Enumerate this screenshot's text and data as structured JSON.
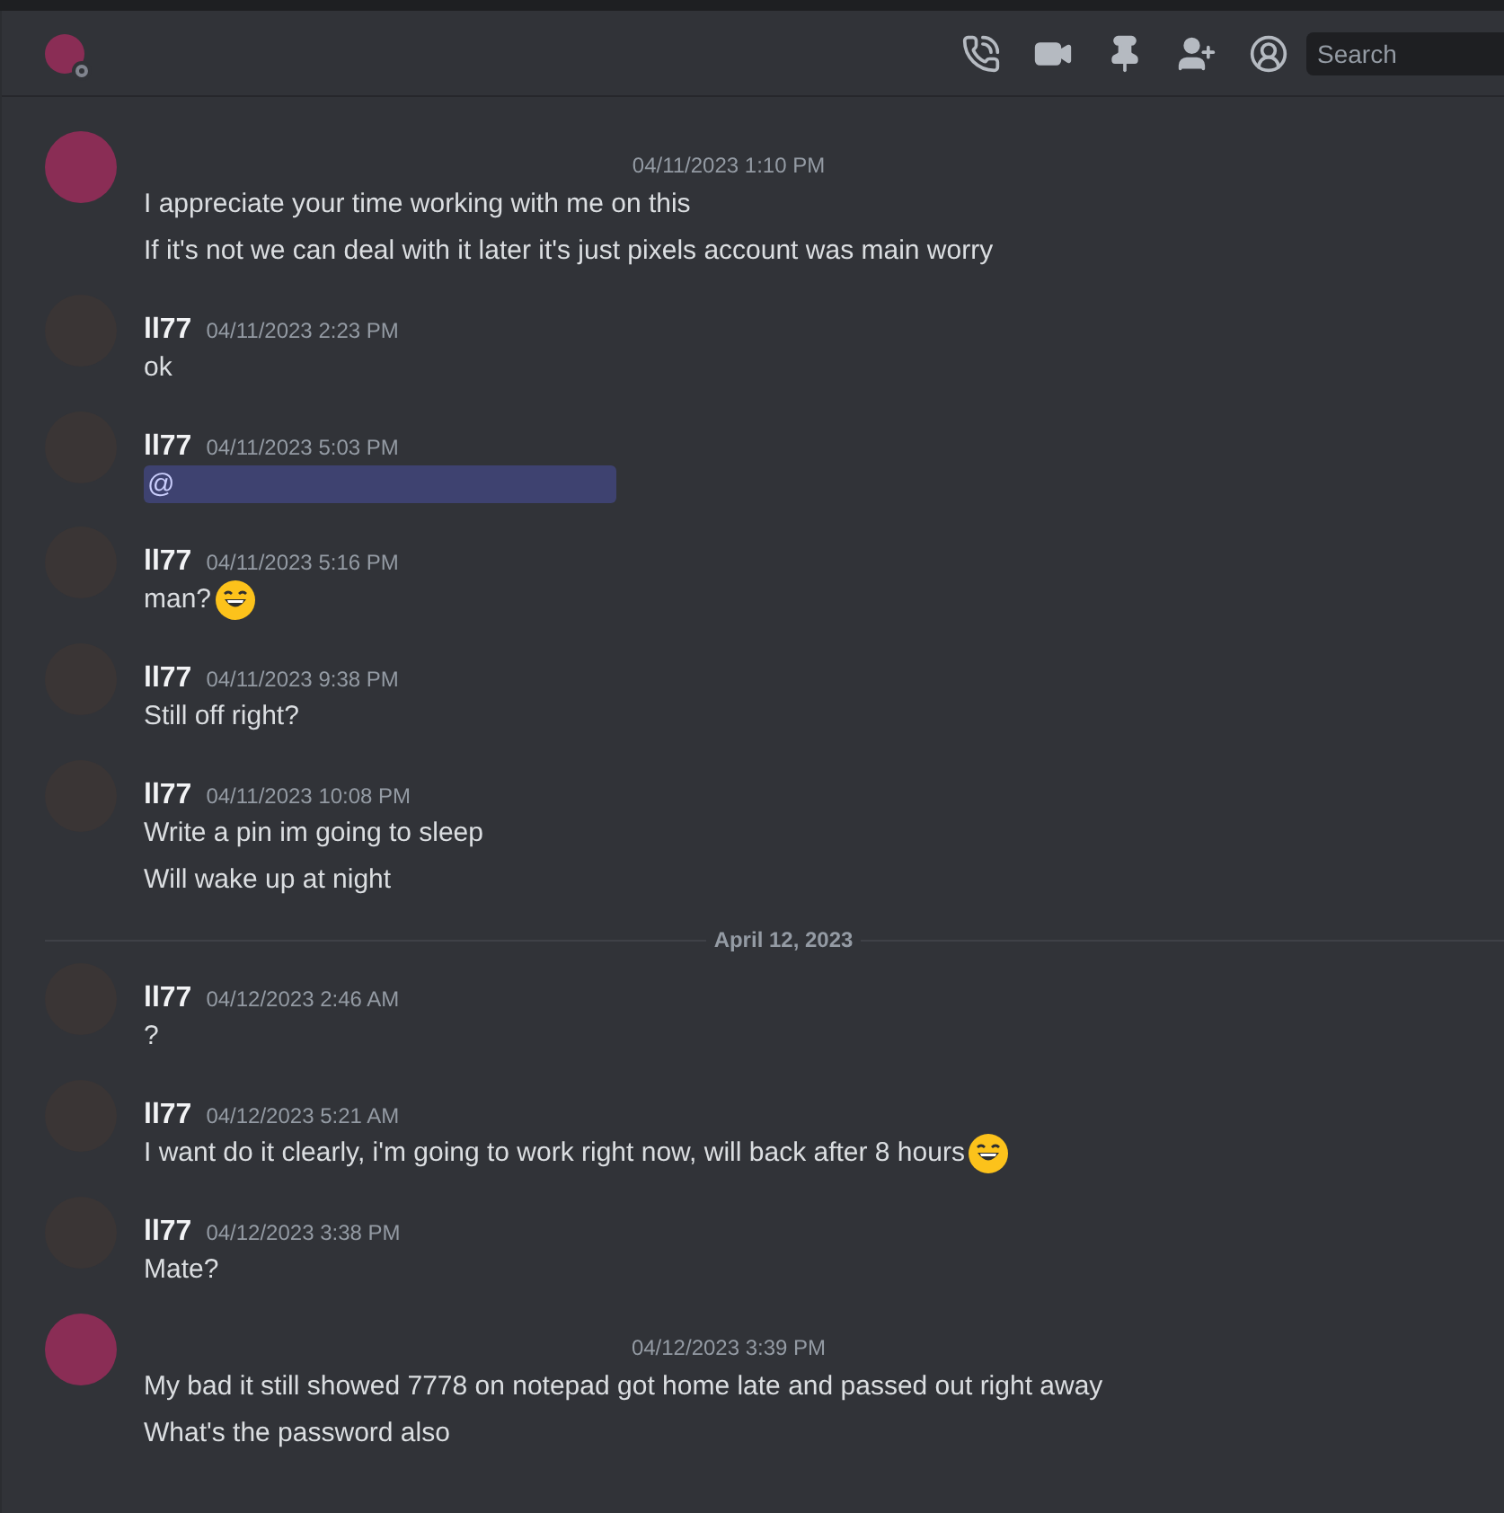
{
  "header": {
    "search": {
      "placeholder": "Search"
    }
  },
  "messages": [
    {
      "kind": "message",
      "timestamp": "04/11/2023 1:10 PM",
      "avatar": {
        "color": "#8a2d55"
      },
      "lines": [
        {
          "kind": "text",
          "text": "I appreciate your time working with me on this"
        },
        {
          "kind": "text",
          "text": "If it's not we can deal with it later it's just pixels account was main worry"
        }
      ]
    },
    {
      "kind": "message",
      "author": "ll77",
      "timestamp": "04/11/2023 2:23 PM",
      "avatar": {
        "color": "#3a3535"
      },
      "lines": [
        {
          "kind": "text",
          "text": "ok"
        }
      ]
    },
    {
      "kind": "message",
      "author": "ll77",
      "timestamp": "04/11/2023 5:03 PM",
      "avatar": {
        "color": "#3a3535"
      },
      "lines": [
        {
          "kind": "mention",
          "text": "@"
        }
      ]
    },
    {
      "kind": "message",
      "author": "ll77",
      "timestamp": "04/11/2023 5:16 PM",
      "avatar": {
        "color": "#3a3535"
      },
      "lines": [
        {
          "kind": "emoji",
          "text": "man?"
        }
      ]
    },
    {
      "kind": "message",
      "author": "ll77",
      "timestamp": "04/11/2023 9:38 PM",
      "avatar": {
        "color": "#3a3535"
      },
      "lines": [
        {
          "kind": "text",
          "text": "Still off right?"
        }
      ]
    },
    {
      "kind": "message",
      "author": "ll77",
      "timestamp": "04/11/2023 10:08 PM",
      "avatar": {
        "color": "#3a3535"
      },
      "lines": [
        {
          "kind": "text",
          "text": "Write a pin im going to sleep"
        },
        {
          "kind": "text",
          "text": "Will wake up at night"
        }
      ]
    },
    {
      "kind": "divider",
      "text": "April 12, 2023"
    },
    {
      "kind": "message",
      "author": "ll77",
      "timestamp": "04/12/2023 2:46 AM",
      "avatar": {
        "color": "#3a3535"
      },
      "lines": [
        {
          "kind": "text",
          "text": "?"
        }
      ]
    },
    {
      "kind": "message",
      "author": "ll77",
      "timestamp": "04/12/2023 5:21 AM",
      "avatar": {
        "color": "#3a3535"
      },
      "lines": [
        {
          "kind": "emoji",
          "text": "I want do it clearly, i'm going to work right now, will back after 8 hours"
        }
      ]
    },
    {
      "kind": "message",
      "author": "ll77",
      "timestamp": "04/12/2023 3:38 PM",
      "avatar": {
        "color": "#3a3535"
      },
      "lines": [
        {
          "kind": "text",
          "text": "Mate?"
        }
      ]
    },
    {
      "kind": "message",
      "timestamp": "04/12/2023 3:39 PM",
      "avatar": {
        "color": "#8a2d55"
      },
      "lines": [
        {
          "kind": "text",
          "text": "My bad it still showed 7778 on notepad got home late and passed out right away"
        },
        {
          "kind": "text",
          "text": "What's the password also"
        }
      ]
    }
  ]
}
